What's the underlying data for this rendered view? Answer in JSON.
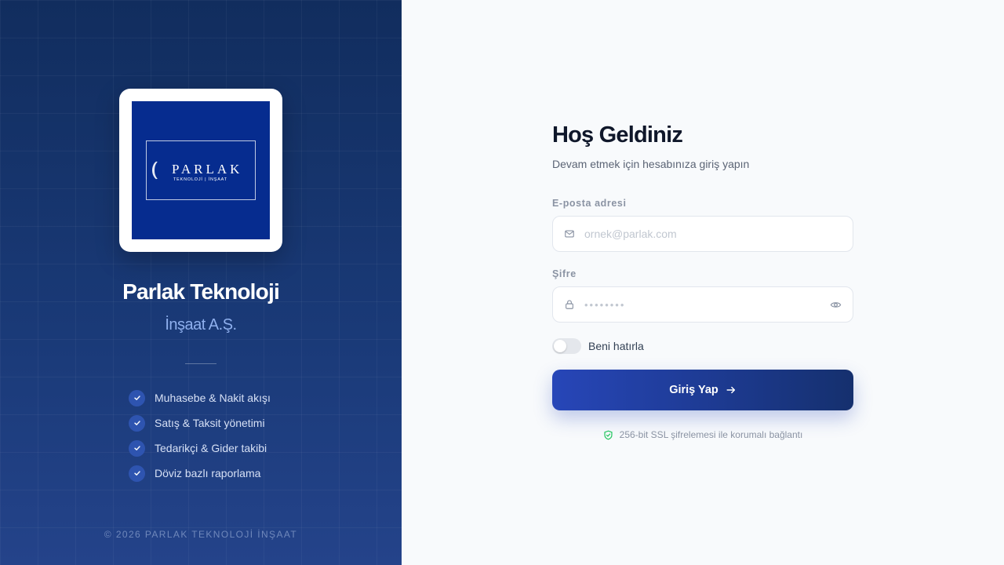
{
  "brand": {
    "logo_word": "PARLAK",
    "logo_subtext": "TEKNOLOJİ | İNŞAAT",
    "title": "Parlak Teknoloji",
    "subtitle": "İnşaat A.Ş."
  },
  "features": [
    {
      "label": "Muhasebe & Nakit akışı"
    },
    {
      "label": "Satış & Taksit yönetimi"
    },
    {
      "label": "Tedarikçi & Gider takibi"
    },
    {
      "label": "Döviz bazlı raporlama"
    }
  ],
  "copyright": "© 2026 PARLAK TEKNOLOJİ İNŞAAT",
  "login": {
    "title": "Hoş Geldiniz",
    "subtitle": "Devam etmek için hesabınıza giriş yapın",
    "email_label": "E-posta adresi",
    "email_placeholder": "ornek@parlak.com",
    "password_label": "Şifre",
    "password_placeholder": "••••••••",
    "remember_label": "Beni hatırla",
    "remember_checked": false,
    "submit_label": "Giriş Yap",
    "ssl_note": "256-bit SSL şifrelemesi ile korumalı bağlantı"
  },
  "icons": {
    "email": "mail-icon",
    "password": "lock-icon",
    "toggle_visibility": "eye-icon",
    "submit_arrow": "arrow-right-icon",
    "feature_check": "check-icon",
    "ssl": "shield-check-icon"
  },
  "colors": {
    "left_panel_top": "#112d5e",
    "left_panel_bottom": "#24438a",
    "logo_background": "#062c8f",
    "accent": "#2746b8",
    "button_end": "#15306e",
    "ssl_green": "#22c55e",
    "page_background": "#f8fafc"
  }
}
